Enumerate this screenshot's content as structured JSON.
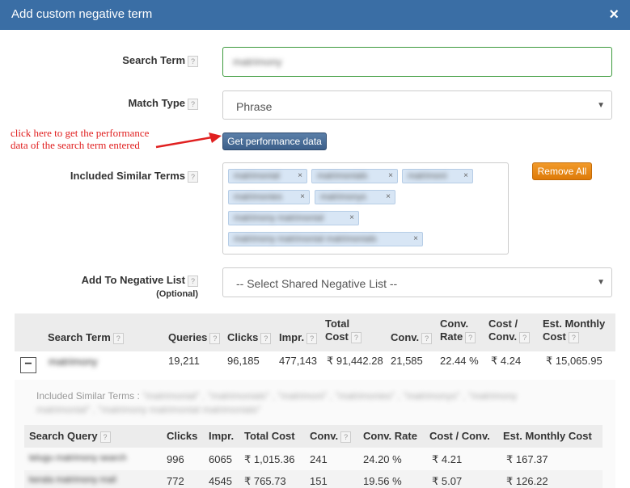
{
  "dialog": {
    "title": "Add custom negative term",
    "close_glyph": "×"
  },
  "help_glyph": "?",
  "form": {
    "search_term_label": "Search Term",
    "search_term_value": "matrimony",
    "match_type_label": "Match Type",
    "match_type_value": "Phrase",
    "perf_button": "Get performance data",
    "included_label": "Included Similar Terms",
    "remove_all": "Remove All",
    "tags": [
      "matrimonial",
      "matrimonials",
      "matrimoni",
      "matrimonies",
      "matrimonys",
      "matrimony matrimonial",
      "matrimony matrimonial matrimonials"
    ],
    "tag_remove_glyph": "×",
    "negative_list_label": "Add To Negative List",
    "negative_list_optional": "(Optional)",
    "negative_list_placeholder": "-- Select Shared Negative List --"
  },
  "annotation": {
    "line1": "click here to get the performance",
    "line2": "data of the search term entered"
  },
  "summary_table": {
    "headers": {
      "search_term": "Search Term",
      "queries": "Queries",
      "clicks": "Clicks",
      "impr": "Impr.",
      "total_cost_1": "Total",
      "total_cost_2": "Cost",
      "conv": "Conv.",
      "conv_rate_1": "Conv.",
      "conv_rate_2": "Rate",
      "cost_conv_1": "Cost /",
      "cost_conv_2": "Conv.",
      "est_1": "Est. Monthly",
      "est_2": "Cost"
    },
    "row": {
      "expand_glyph": "−",
      "search_term": "matrimony",
      "queries": "19,211",
      "clicks": "96,185",
      "impr": "477,143",
      "total_cost": "₹ 91,442.28",
      "conv": "21,585",
      "conv_rate": "22.44 %",
      "cost_conv": "₹ 4.24",
      "est_monthly": "₹ 15,065.95"
    }
  },
  "included_terms_line": {
    "label": "Included Similar Terms :",
    "terms": "\"matrimonial\" , \"matrimonials\" , \"matrimoni\" , \"matrimonies\" , \"matrimonys\" , \"matrimony matrimonial\" , \"matrimony matrimonial matrimonials\""
  },
  "query_table": {
    "headers": {
      "search_query": "Search Query",
      "clicks": "Clicks",
      "impr": "Impr.",
      "total_cost": "Total Cost",
      "conv": "Conv.",
      "conv_rate": "Conv. Rate",
      "cost_conv": "Cost / Conv.",
      "est_monthly": "Est. Monthly Cost"
    },
    "rows": [
      {
        "query": "telugu matrimony search",
        "clicks": "996",
        "impr": "6065",
        "total_cost": "₹ 1,015.36",
        "conv": "241",
        "conv_rate": "24.20 %",
        "cost_conv": "₹ 4.21",
        "est_monthly": "₹ 167.37"
      },
      {
        "query": "kerala matrimony mail",
        "clicks": "772",
        "impr": "4545",
        "total_cost": "₹ 765.73",
        "conv": "151",
        "conv_rate": "19.56 %",
        "cost_conv": "₹ 5.07",
        "est_monthly": "₹ 126.22"
      }
    ]
  },
  "colors": {
    "titlebar": "#3a6ea5",
    "perf_button": "#3c5f8a",
    "remove_button": "#de7a08",
    "annotation": "#e02020",
    "input_focus_border": "#3c9a3c"
  }
}
